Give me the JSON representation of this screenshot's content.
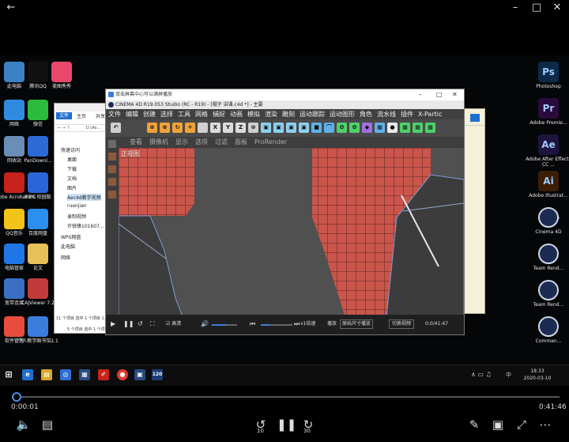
{
  "player": {
    "current_time": "0:00:01",
    "total_time": "0:41:46",
    "progress_fraction": 0.0004,
    "rewind_seconds": "10",
    "forward_seconds": "30"
  },
  "desktop": {
    "left_icons": [
      {
        "label": "此电脑",
        "icon": "computer-icon",
        "color": "#3b82c4"
      },
      {
        "label": "腾讯QQ",
        "icon": "qq-icon",
        "color": "#111111"
      },
      {
        "label": "美图秀秀",
        "icon": "meitu-icon",
        "color": "#e9486b"
      },
      {
        "label": "网络",
        "icon": "network-icon",
        "color": "#2f8be0"
      },
      {
        "label": "微信",
        "icon": "wechat-icon",
        "color": "#2dbb3c"
      },
      {
        "label": "回收站",
        "icon": "recycle-bin-icon",
        "color": "#6a8eb5"
      },
      {
        "label": "PanDownl...",
        "icon": "pandownload-icon",
        "color": "#2c6bd6"
      },
      {
        "label": "Adobe Acrobat DC",
        "icon": "acrobat-icon",
        "color": "#c7221b"
      },
      {
        "label": "WPS 校园版",
        "icon": "wps-icon",
        "color": "#2a66d8"
      },
      {
        "label": "QQ音乐",
        "icon": "qq-music-icon",
        "color": "#f2c417"
      },
      {
        "label": "百度网盘",
        "icon": "baidu-netdisk-icon",
        "color": "#2b8ff0"
      },
      {
        "label": "电脑管家",
        "icon": "pc-manager-icon",
        "color": "#1f76e6"
      },
      {
        "label": "论文",
        "icon": "folder-icon",
        "color": "#e8c05a"
      },
      {
        "label": "宽带连接",
        "icon": "broadband-icon",
        "color": "#3a6fc4"
      },
      {
        "label": "CAJViewer 7.2",
        "icon": "cajviewer-icon",
        "color": "#c23b3b"
      },
      {
        "label": "软件管理",
        "icon": "software-manager-icon",
        "color": "#e94c3d"
      },
      {
        "label": "个人教学图书馆2.1",
        "icon": "library-icon",
        "color": "#3b7ddd"
      }
    ],
    "right_icons": [
      {
        "label": "Photoshop",
        "abbr": "Ps",
        "icon": "photoshop-icon",
        "color": "#0d2a4b"
      },
      {
        "label": "Adobe Premie...",
        "abbr": "Pr",
        "icon": "premiere-icon",
        "color": "#2a0b3d"
      },
      {
        "label": "Adobe After Effects CC ...",
        "abbr": "Ae",
        "icon": "after-effects-icon",
        "color": "#1d1540"
      },
      {
        "label": "Adobe Illustrat...",
        "abbr": "Ai",
        "icon": "illustrator-icon",
        "color": "#3b1e05"
      },
      {
        "label": "Cinema 4D",
        "abbr": "",
        "icon": "cinema4d-icon",
        "color": "#1c2b52"
      },
      {
        "label": "Team Rend...",
        "abbr": "",
        "icon": "team-render-icon",
        "color": "#1c2b52"
      },
      {
        "label": "Team Rend...",
        "abbr": "",
        "icon": "team-render-icon",
        "color": "#1c2b52"
      },
      {
        "label": "Comman...",
        "abbr": "",
        "icon": "commandline-icon",
        "color": "#1c2b52"
      }
    ]
  },
  "explorer": {
    "tabs": [
      "文件",
      "主页",
      "共享"
    ],
    "path": "D:\\Ae...",
    "items": [
      "快速访问",
      "桌面",
      "下载",
      "文档",
      "图片",
      "Aec4d教学视频",
      "ruanjian",
      "录制视频",
      "许锐锋101607...",
      "WPS网盘",
      "此电脑",
      "网络"
    ],
    "footer1": "11 个项目",
    "footer1b": "选中 1 个项目 1.8",
    "footer2": "5 个项目",
    "footer2b": "选中 1 个项目"
  },
  "recorder": {
    "title": "双击屏幕中心可以满屏播放",
    "c4d_title": "CINEMA 4D R19.053 Studio (RC - R19) - [帽子 讲课.c4d *] - 主要",
    "menu": [
      "文件",
      "编辑",
      "创建",
      "选择",
      "工具",
      "网格",
      "捕捉",
      "动画",
      "模拟",
      "渲染",
      "雕刻",
      "运动跟踪",
      "运动图形",
      "角色",
      "流水线",
      "插件",
      "X-Partic"
    ],
    "view_menu": [
      "查看",
      "摄像机",
      "显示",
      "选项",
      "过滤",
      "面板",
      "ProRender"
    ],
    "viewport_label": "正视图",
    "controls": {
      "hd_label": "高清",
      "speed": "x1倍速",
      "play_label": "播放",
      "size_label": "原始尺寸播放",
      "switch_label": "切换视频",
      "time": "0:0/41:47"
    }
  },
  "taskbar": {
    "time": "18:33",
    "date": "2020-03-10",
    "ime": "中",
    "tray_badge": "120"
  }
}
